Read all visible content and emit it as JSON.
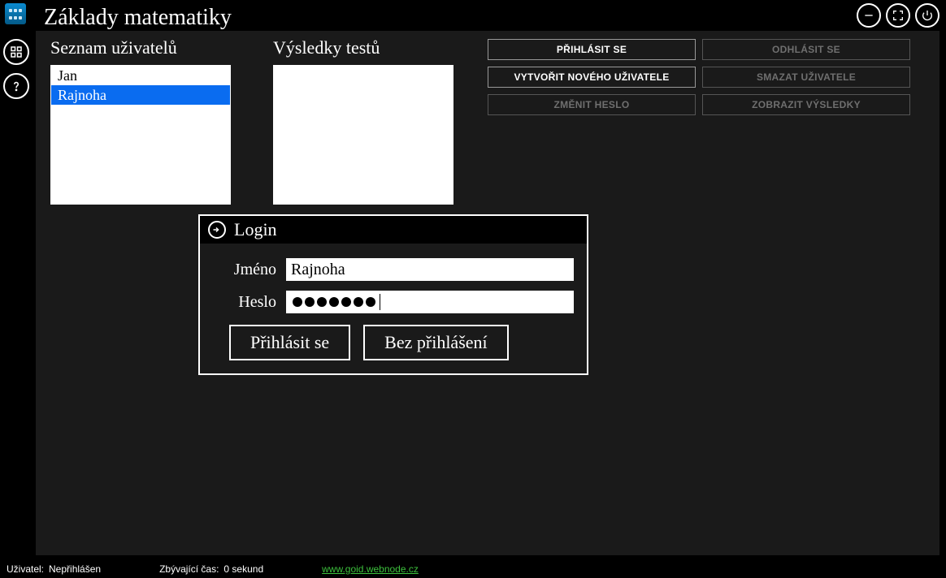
{
  "app": {
    "title": "Základy matematiky"
  },
  "sections": {
    "users_label": "Seznam uživatelů",
    "tests_label": "Výsledky testů"
  },
  "users": [
    {
      "name": "Jan",
      "selected": false
    },
    {
      "name": "Rajnoha",
      "selected": true
    }
  ],
  "actions": {
    "login": "PŘIHLÁSIT SE",
    "logout": "ODHLÁSIT SE",
    "create_user": "VYTVOŘIT NOVÉHO UŽIVATELE",
    "delete_user": "SMAZAT UŽIVATELE",
    "change_pass": "ZMĚNIT HESLO",
    "show_results": "ZOBRAZIT VÝSLEDKY"
  },
  "actions_state": {
    "login": true,
    "logout": false,
    "create_user": true,
    "delete_user": false,
    "change_pass": false,
    "show_results": false
  },
  "dialog": {
    "title": "Login",
    "name_label": "Jméno",
    "pass_label": "Heslo",
    "name_value": "Rajnoha",
    "pass_dots": 7,
    "login_btn": "Přihlásit se",
    "skip_btn": "Bez přihlášení"
  },
  "status": {
    "user_label": "Uživatel:",
    "user_value": "Nepřihlášen",
    "time_label": "Zbývající čas:",
    "time_value": "0 sekund",
    "link": "www.goid.webnode.cz"
  }
}
